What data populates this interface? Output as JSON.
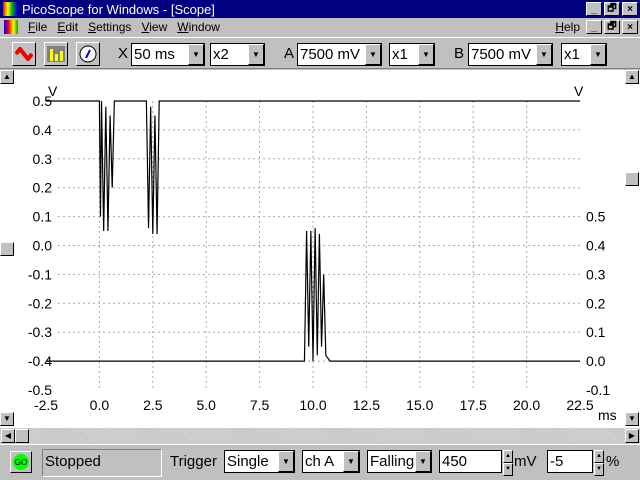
{
  "window": {
    "title": "PicoScope for Windows - [Scope]",
    "min": "_",
    "max": "🗗",
    "close": "×"
  },
  "menu": {
    "items": [
      "File",
      "Edit",
      "Settings",
      "View",
      "Window"
    ],
    "help": "Help"
  },
  "toolbar": {
    "x_label": "X",
    "timebase": "50 ms",
    "x_mult": "x2",
    "a_label": "A",
    "a_range": "7500 mV",
    "a_mult": "x1",
    "b_label": "B",
    "b_range": "7500 mV",
    "b_mult": "x1"
  },
  "status": {
    "go": "GO",
    "state": "Stopped",
    "trigger_label": "Trigger",
    "mode": "Single",
    "channel": "ch A",
    "edge": "Falling",
    "level": "450",
    "level_unit": "mV",
    "delay": "-5",
    "delay_unit": "%"
  },
  "chart_data": {
    "type": "line",
    "xlabel": "ms",
    "x_ticks": [
      "-2.5",
      "0.0",
      "2.5",
      "5.0",
      "7.5",
      "10.0",
      "12.5",
      "15.0",
      "17.5",
      "20.0",
      "22.5"
    ],
    "xlim": [
      -2.5,
      22.5
    ],
    "left_axis": {
      "unit": "V",
      "ylim": [
        -0.5,
        0.5
      ],
      "ticks": [
        "0.5",
        "0.4",
        "0.3",
        "0.2",
        "0.1",
        "0.0",
        "-0.1",
        "-0.2",
        "-0.3",
        "-0.4",
        "-0.5"
      ]
    },
    "right_axis": {
      "unit": "V",
      "ylim": [
        -0.1,
        0.5
      ],
      "ticks": [
        "0.5",
        "0.4",
        "0.3",
        "0.2",
        "0.1",
        "0.0",
        "-0.1"
      ]
    },
    "grid": true,
    "series": [
      {
        "name": "A",
        "axis": "left",
        "color": "#000000",
        "points": [
          [
            -2.5,
            0.5
          ],
          [
            0.0,
            0.5
          ],
          [
            0.05,
            0.1
          ],
          [
            0.1,
            0.5
          ],
          [
            0.2,
            0.05
          ],
          [
            0.3,
            0.48
          ],
          [
            0.4,
            0.05
          ],
          [
            0.5,
            0.45
          ],
          [
            0.6,
            0.2
          ],
          [
            0.7,
            0.5
          ],
          [
            2.2,
            0.5
          ],
          [
            2.3,
            0.06
          ],
          [
            2.4,
            0.48
          ],
          [
            2.5,
            0.04
          ],
          [
            2.6,
            0.45
          ],
          [
            2.7,
            0.04
          ],
          [
            2.8,
            0.5
          ],
          [
            22.5,
            0.5
          ]
        ]
      },
      {
        "name": "B",
        "axis": "right",
        "color": "#000000",
        "points": [
          [
            -2.5,
            0
          ],
          [
            9.6,
            0
          ],
          [
            9.7,
            0.45
          ],
          [
            9.8,
            0.05
          ],
          [
            9.9,
            0.45
          ],
          [
            10.0,
            0.0
          ],
          [
            10.1,
            0.46
          ],
          [
            10.2,
            0.02
          ],
          [
            10.3,
            0.44
          ],
          [
            10.4,
            0.05
          ],
          [
            10.5,
            0.3
          ],
          [
            10.6,
            0.02
          ],
          [
            10.8,
            0
          ],
          [
            22.5,
            0
          ]
        ]
      }
    ]
  }
}
